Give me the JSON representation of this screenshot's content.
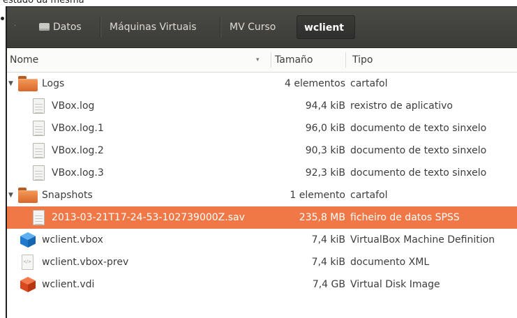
{
  "caption": {
    "text": "estado da mesma"
  },
  "pathbar": {
    "crumbs": [
      {
        "label": "Datos"
      },
      {
        "label": "Máquinas Virtuais"
      },
      {
        "label": "MV Curso"
      },
      {
        "label": "wclient"
      }
    ]
  },
  "columns": {
    "name": "Nome",
    "size": "Tamaño",
    "type": "Tipo"
  },
  "rows": [
    {
      "name": "Logs",
      "size": "4 elementos",
      "type": "cartafol",
      "icon": "folder-icon",
      "expanded": true
    },
    {
      "name": "VBox.log",
      "size": "94,4 kiB",
      "type": "rexistro de aplicativo",
      "icon": "text-file-icon"
    },
    {
      "name": "VBox.log.1",
      "size": "96,0 kiB",
      "type": "documento de texto sinxelo",
      "icon": "text-file-icon"
    },
    {
      "name": "VBox.log.2",
      "size": "90,3 kiB",
      "type": "documento de texto sinxelo",
      "icon": "text-file-icon"
    },
    {
      "name": "VBox.log.3",
      "size": "92,3 kiB",
      "type": "documento de texto sinxelo",
      "icon": "text-file-icon"
    },
    {
      "name": "Snapshots",
      "size": "1 elemento",
      "type": "cartafol",
      "icon": "folder-icon",
      "expanded": true
    },
    {
      "name": "2013-03-21T17-24-53-102739000Z.sav",
      "size": "235,8 MB",
      "type": "ficheiro de datos SPSS",
      "icon": "text-file-icon",
      "selected": true
    },
    {
      "name": "wclient.vbox",
      "size": "7,4 kiB",
      "type": "VirtualBox Machine Definition",
      "icon": "virtualbox-cube-icon"
    },
    {
      "name": "wclient.vbox-prev",
      "size": "7,4 kiB",
      "type": "documento XML",
      "icon": "xml-file-icon"
    },
    {
      "name": "wclient.vdi",
      "size": "7,4 GB",
      "type": "Virtual Disk Image",
      "icon": "disk-image-cube-icon"
    }
  ],
  "colors": {
    "selection": "#f07846",
    "pathbar": "#3f3f3c",
    "folder": "#e67a3a",
    "vbox_cube": "#1f7bd0",
    "vdi_cube": "#d9481e"
  }
}
